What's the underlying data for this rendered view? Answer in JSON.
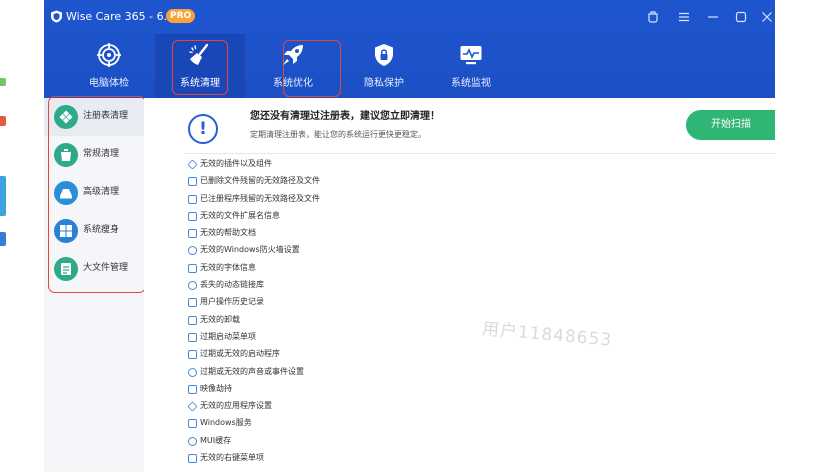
{
  "window": {
    "title": "Wise Care 365 - 6.6.6",
    "badge": "PRO",
    "controls": [
      "settings-icon",
      "menu-icon",
      "minimize-icon",
      "maximize-icon",
      "close-icon"
    ]
  },
  "nav": {
    "tabs": [
      {
        "label": "电脑体检",
        "icon": "target-icon"
      },
      {
        "label": "系统清理",
        "icon": "broom-icon",
        "active": true
      },
      {
        "label": "系统优化",
        "icon": "rocket-icon"
      },
      {
        "label": "隐私保护",
        "icon": "shield-lock-icon"
      },
      {
        "label": "系统监视",
        "icon": "monitor-pulse-icon"
      }
    ]
  },
  "sidebar": {
    "items": [
      {
        "label": "注册表清理",
        "icon": "registry-icon",
        "active": true
      },
      {
        "label": "常规清理",
        "icon": "trash-icon"
      },
      {
        "label": "高级清理",
        "icon": "disk-icon"
      },
      {
        "label": "系统瘦身",
        "icon": "windows-icon"
      },
      {
        "label": "大文件管理",
        "icon": "file-icon"
      }
    ]
  },
  "main": {
    "warning_title": "您还没有清理过注册表，建议您立即清理！",
    "warning_subtitle": "定期清理注册表，能让您的系统运行更快更稳定。",
    "scan_button": "开始扫描",
    "items": [
      "无效的插件以及组件",
      "已删除文件残留的无效路径及文件",
      "已注册程序残留的无效路径及文件",
      "无效的文件扩展名信息",
      "无效的帮助文档",
      "无效的Windows防火墙设置",
      "无效的字体信息",
      "丢失的动态链接库",
      "用户操作历史记录",
      "无效的卸载",
      "过期启动菜单项",
      "过期或无效的启动程序",
      "过期或无效的声音或事件设置",
      "映像劫持",
      "无效的应用程序设置",
      "Windows服务",
      "MUI缓存",
      "无效的右键菜单项"
    ],
    "watermark": "用户11848653"
  },
  "colors": {
    "header_blue": "#1e56cf",
    "accent_green": "#2fb574",
    "highlight_red": "#e0473b",
    "sidebar_green": "#2eaa8a",
    "badge_orange": "#f7a23a"
  }
}
